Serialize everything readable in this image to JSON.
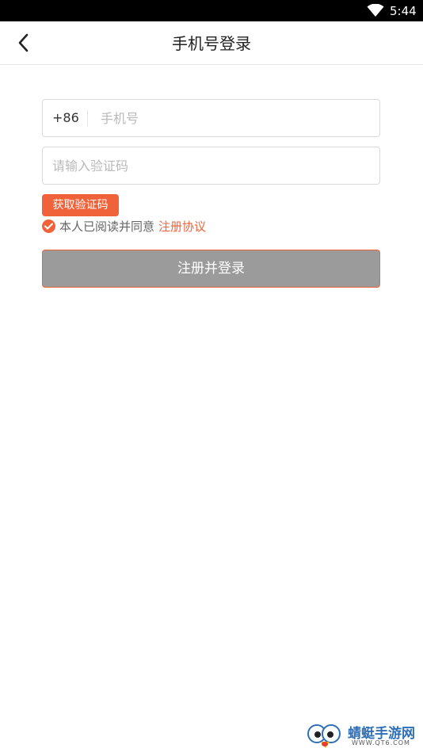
{
  "status_bar": {
    "time": "5:44"
  },
  "header": {
    "title": "手机号登录"
  },
  "phone_field": {
    "prefix": "+86",
    "placeholder": "手机号",
    "value": ""
  },
  "code_field": {
    "placeholder": "请输入验证码",
    "value": ""
  },
  "get_code_button": {
    "label": "获取验证码"
  },
  "agreement": {
    "checked": true,
    "text": "本人已阅读并同意",
    "link_label": "注册协议"
  },
  "submit_button": {
    "label": "注册并登录"
  },
  "watermark": {
    "name": "蜻蜓手游网",
    "url": "WWW.QT6.COM"
  },
  "colors": {
    "accent": "#f0623a",
    "submit_disabled": "#9b9b9b",
    "status_bar": "#000000"
  },
  "icons": {
    "back": "chevron-left-icon",
    "wifi": "wifi-icon",
    "check": "check-circle-icon"
  }
}
